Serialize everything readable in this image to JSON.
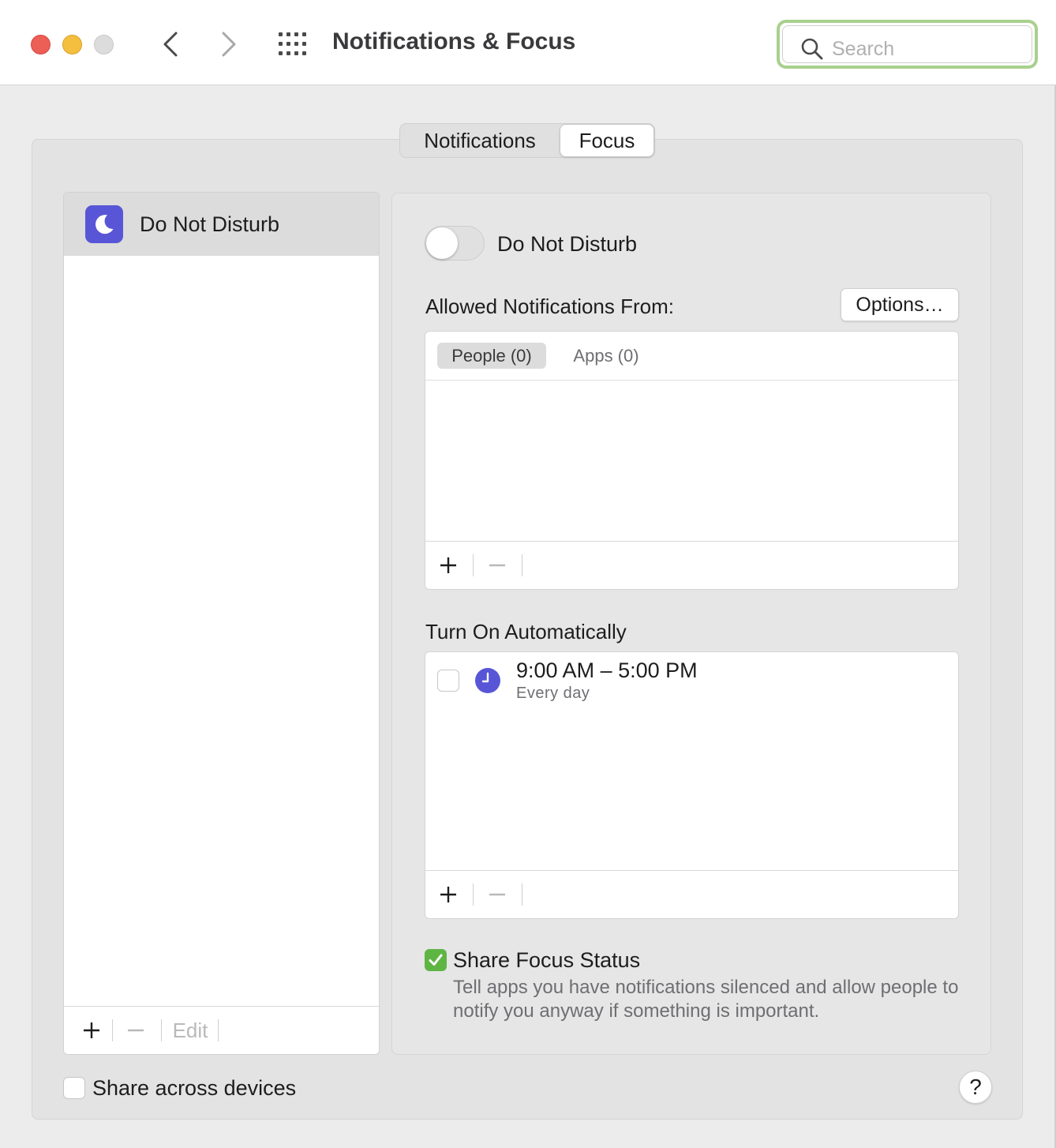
{
  "window": {
    "title": "Notifications & Focus"
  },
  "search": {
    "placeholder": "Search",
    "value": ""
  },
  "tabs": [
    {
      "label": "Notifications",
      "selected": false
    },
    {
      "label": "Focus",
      "selected": true
    }
  ],
  "focus_list": {
    "items": [
      {
        "label": "Do Not Disturb",
        "icon": "moon-icon",
        "selected": true
      }
    ],
    "toolbar": {
      "add": "+",
      "remove": "−",
      "edit": "Edit"
    }
  },
  "detail": {
    "toggle_label": "Do Not Disturb",
    "toggle_on": false,
    "allowed_label": "Allowed Notifications From:",
    "options_label": "Options…",
    "subtabs": [
      {
        "label": "People (0)",
        "selected": true
      },
      {
        "label": "Apps (0)",
        "selected": false
      }
    ],
    "allowed_toolbar": {
      "add": "+",
      "remove": "−"
    },
    "turn_on_label": "Turn On Automatically",
    "schedules": [
      {
        "time": "9:00 AM – 5:00 PM",
        "repeat": "Every day",
        "enabled": false,
        "icon": "clock-icon"
      }
    ],
    "schedule_toolbar": {
      "add": "+",
      "remove": "−"
    },
    "share_focus": {
      "label": "Share Focus Status",
      "checked": true,
      "description": "Tell apps you have notifications silenced and allow people to notify you anyway if something is important."
    }
  },
  "share_devices": {
    "label": "Share across devices",
    "checked": false
  },
  "help_label": "?",
  "colors": {
    "accent_purple": "#5856d6",
    "check_green": "#5fb544",
    "search_highlight": "#a9d08e",
    "close_red": "#ec5f57",
    "minimize_yellow": "#f4be3f"
  }
}
